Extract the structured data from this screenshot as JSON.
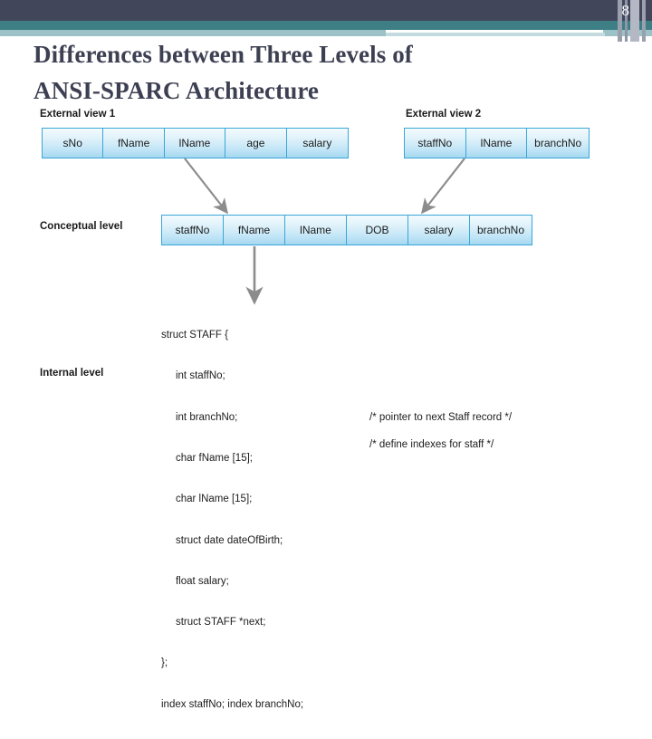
{
  "header": {
    "page_number": "8",
    "accent_dark": "#41465a",
    "accent_teal": "#3d7f85",
    "accent_light": "#9cc2c8"
  },
  "title": {
    "line1": "Differences between Three Levels of",
    "line2": "ANSI-SPARC Architecture",
    "color": "#3d4052"
  },
  "diagram": {
    "cell_border_color": "#3aa6d8",
    "arrow_color": "#8c8c8c",
    "levels": {
      "external_view_1": {
        "label": "External view 1",
        "cells": [
          "sNo",
          "fName",
          "lName",
          "age",
          "salary"
        ]
      },
      "external_view_2": {
        "label": "External view 2",
        "cells": [
          "staffNo",
          "lName",
          "branchNo"
        ]
      },
      "conceptual": {
        "label": "Conceptual level",
        "cells": [
          "staffNo",
          "fName",
          "lName",
          "DOB",
          "salary",
          "branchNo"
        ]
      },
      "internal": {
        "label": "Internal level",
        "code_lines": [
          "struct STAFF {",
          "     int staffNo;",
          "     int branchNo;",
          "     char fName [15];",
          "     char lName [15];",
          "     struct date dateOfBirth;",
          "     float salary;",
          "     struct STAFF *next;",
          "};",
          "index staffNo; index branchNo;"
        ],
        "comment_next": "/* pointer to next Staff record */",
        "comment_index": "/* define indexes for staff */"
      }
    }
  }
}
